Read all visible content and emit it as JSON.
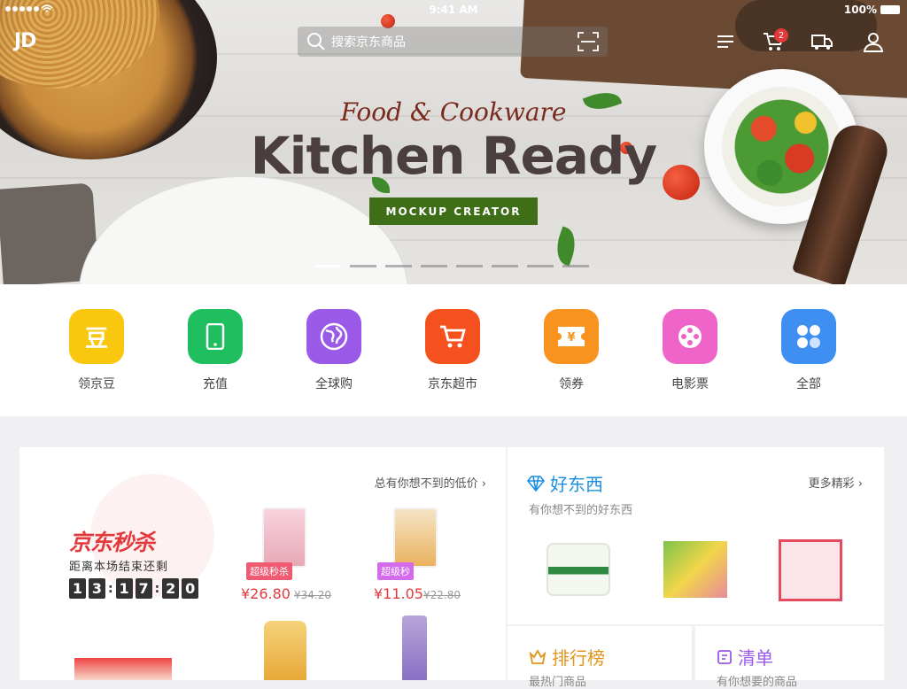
{
  "status": {
    "time": "9:41 AM",
    "battery": "100%"
  },
  "topbar": {
    "logo": "JD",
    "search_placeholder": "搜索京东商品",
    "cart_count": "2"
  },
  "banner": {
    "subtitle": "Food & Cookware",
    "title": "Kitchen Ready",
    "button": "MOCKUP CREATOR",
    "slides": 8,
    "active_slide": 1
  },
  "categories": [
    {
      "label": "领京豆",
      "color": "#f9c80e",
      "icon": "bean-icon"
    },
    {
      "label": "充值",
      "color": "#1fbf5f",
      "icon": "phone-icon"
    },
    {
      "label": "全球购",
      "color": "#9b59e8",
      "icon": "globe-icon"
    },
    {
      "label": "京东超市",
      "color": "#f4511e",
      "icon": "cart-icon"
    },
    {
      "label": "领券",
      "color": "#f7931e",
      "icon": "coupon-icon"
    },
    {
      "label": "电影票",
      "color": "#ef64c8",
      "icon": "film-icon"
    },
    {
      "label": "全部",
      "color": "#3f8ef2",
      "icon": "grid-icon"
    }
  ],
  "seckill": {
    "logo": "京东秒杀",
    "subtitle": "距离本场结束还剩",
    "digits": [
      "1",
      "3",
      "1",
      "7",
      "2",
      "0"
    ],
    "hint": "总有你想不到的低价 ›",
    "products": [
      {
        "tag": "超级秒杀",
        "price": "¥26.80",
        "old": "¥34.20",
        "tag_color": "#ef5b73"
      },
      {
        "tag": "超级秒",
        "price": "¥11.05",
        "old": "¥22.80",
        "tag_color": "#d36bea"
      }
    ]
  },
  "good": {
    "title": "好东西",
    "more": "更多精彩 ›",
    "sub": "有你想不到的好东西"
  },
  "rank": {
    "title": "排行榜",
    "sub": "最热门商品"
  },
  "list": {
    "title": "清单",
    "sub": "有你想要的商品"
  }
}
